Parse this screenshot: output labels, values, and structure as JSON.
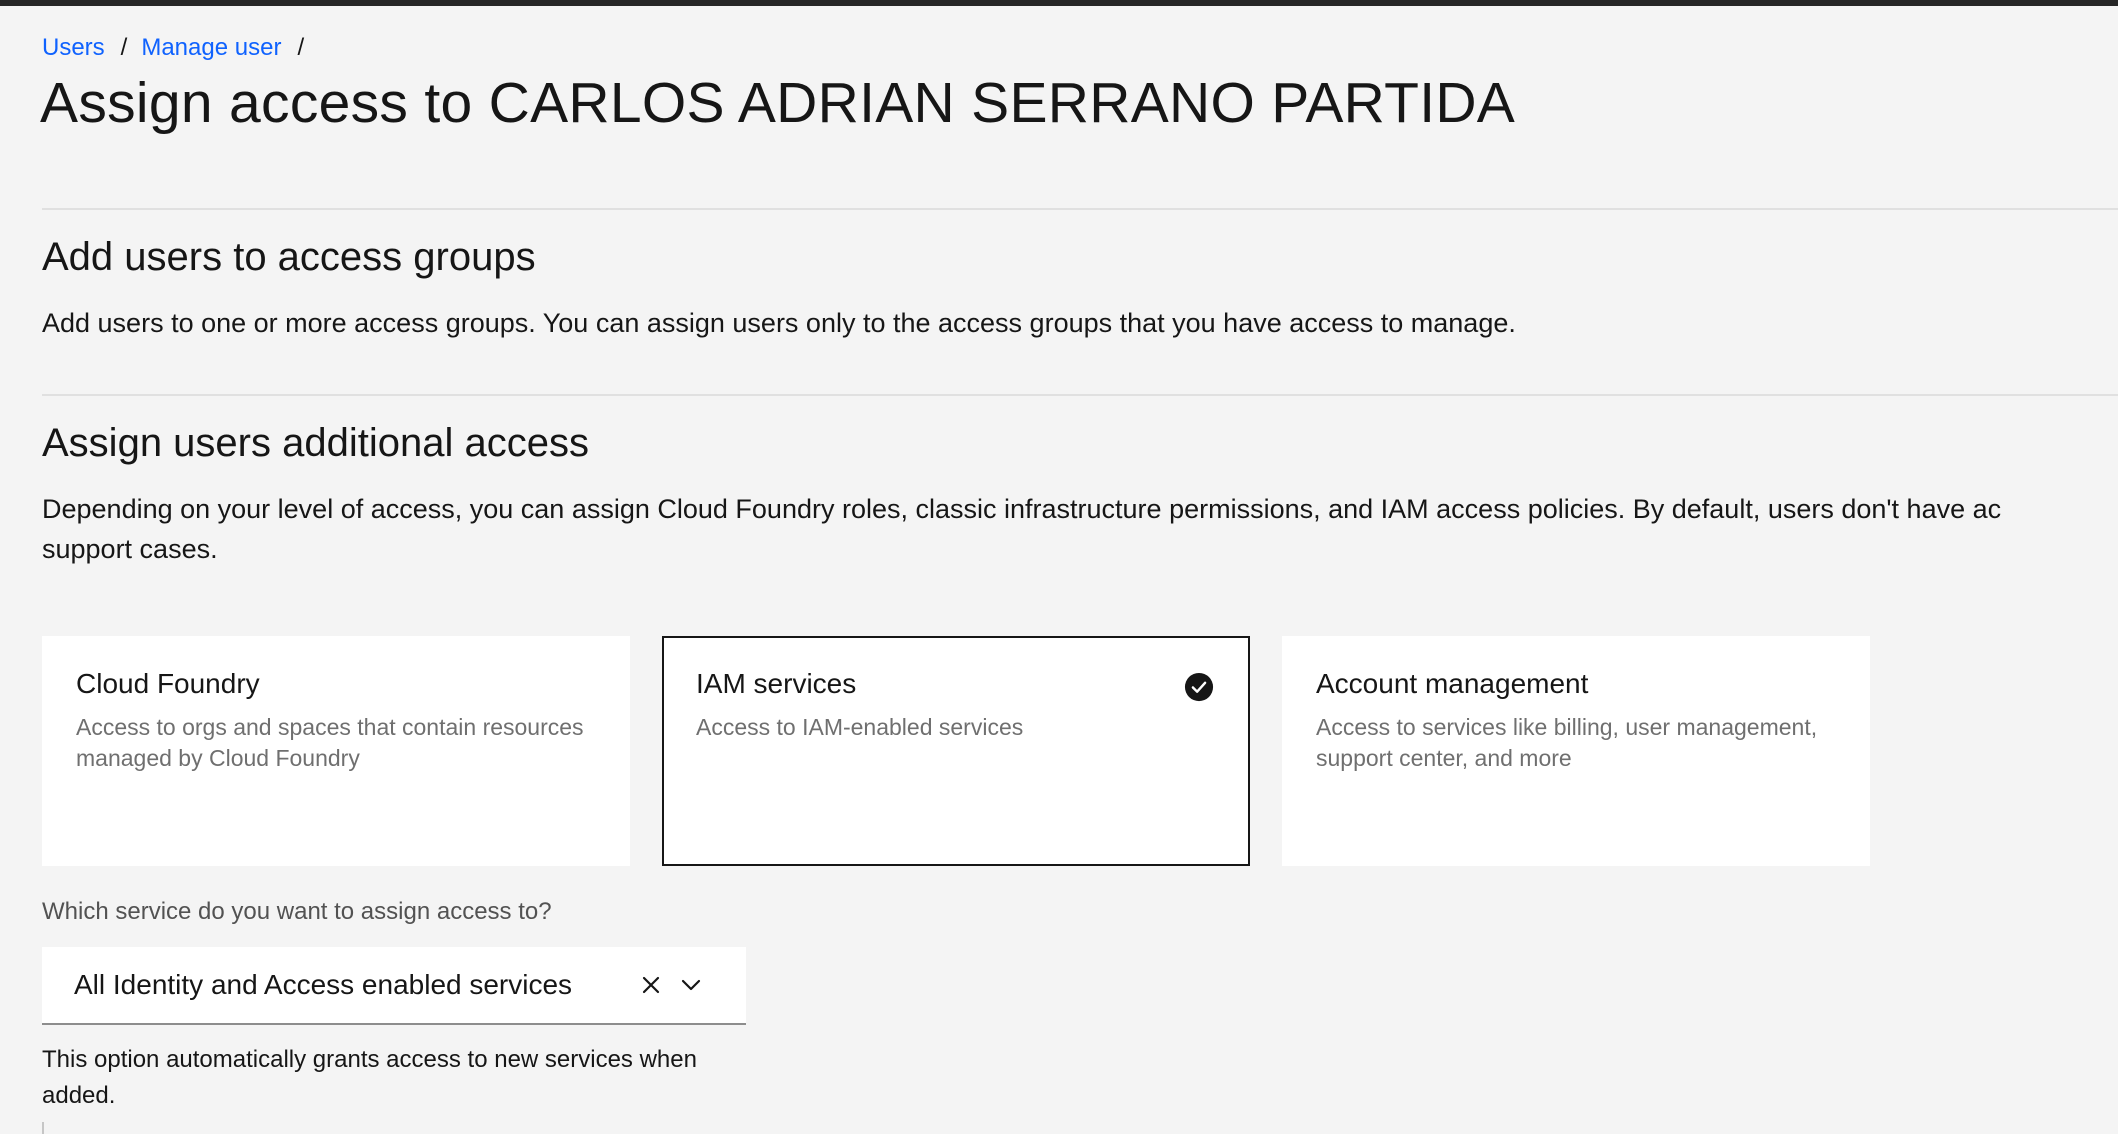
{
  "breadcrumb": {
    "items": [
      "Users",
      "Manage user"
    ],
    "separator": "/"
  },
  "page": {
    "title": "Assign access to CARLOS ADRIAN SERRANO PARTIDA"
  },
  "access_groups": {
    "title": "Add users to access groups",
    "description": "Add users to one or more access groups. You can assign users only to the access groups that you have access to manage."
  },
  "additional_access": {
    "title": "Assign users additional access",
    "description_line1": "Depending on your level of access, you can assign Cloud Foundry roles, classic infrastructure permissions, and IAM access policies. By default, users don't have ac",
    "description_line2": "support cases."
  },
  "tiles": [
    {
      "title": "Cloud Foundry",
      "description": "Access to orgs and spaces that contain resources managed by Cloud Foundry",
      "selected": false
    },
    {
      "title": "IAM services",
      "description": "Access to IAM-enabled services",
      "selected": true,
      "icon": "checkmark-filled-icon"
    },
    {
      "title": "Account management",
      "description": "Access to services like billing, user management, support center, and more",
      "selected": false
    }
  ],
  "service_select": {
    "label": "Which service do you want to assign access to?",
    "value": "All Identity and Access enabled services",
    "helper_text": "This option automatically grants access to new services when added.",
    "clear_icon": "close-icon",
    "open_icon": "chevron-down-icon"
  },
  "colors": {
    "link": "#0f62fe",
    "background": "#f4f4f4",
    "text": "#161616",
    "secondary_text": "#6f6f6f",
    "selected_border": "#161616"
  }
}
